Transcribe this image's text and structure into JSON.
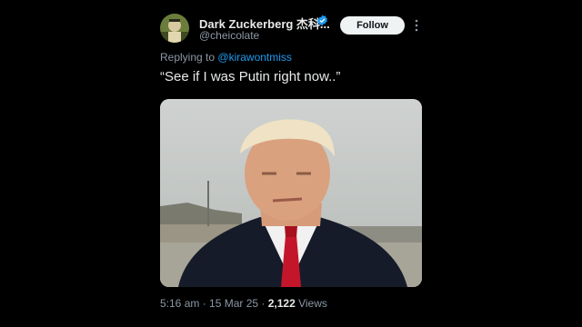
{
  "author": {
    "display_name": "Dark Zuckerberg 杰科...",
    "handle": "@cheicolate",
    "verified": true,
    "avatar_icon": "avatar-image"
  },
  "actions": {
    "follow_label": "Follow",
    "more_icon": "more-vertical-icon"
  },
  "reply": {
    "prefix": "Replying to",
    "mention": "@kirawontmiss"
  },
  "tweet": {
    "text": "“See if I was Putin right now..”"
  },
  "media": {
    "type": "video-thumbnail",
    "icon": "media-image"
  },
  "meta": {
    "time": "5:16 am",
    "separator1": " · ",
    "date": "15 Mar 25",
    "separator2": " · ",
    "views_count": "2,122",
    "views_label": " Views"
  },
  "colors": {
    "background": "#000000",
    "text_primary": "#e7e9ea",
    "text_secondary": "#8b98a5",
    "link": "#1d9bf0",
    "follow_button_bg": "#eff3f4"
  }
}
